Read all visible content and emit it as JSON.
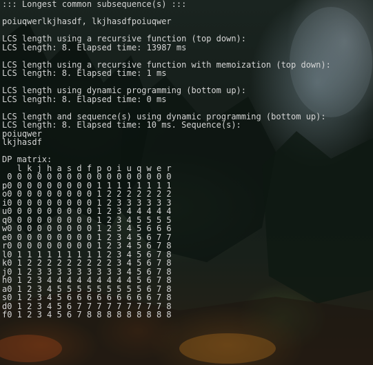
{
  "console": {
    "lines": [
      "::: Longest common subsequence(s) :::",
      "",
      "poiuqwerlkjhasdf, lkjhasdfpoiuqwer",
      "",
      "LCS length using a recursive function (top down):",
      "LCS length: 8. Elapsed time: 13987 ms",
      "",
      "LCS length using a recursive function with memoization (top down):",
      "LCS length: 8. Elapsed time: 1 ms",
      "",
      "LCS length using dynamic programming (bottom up):",
      "LCS length: 8. Elapsed time: 0 ms",
      "",
      "LCS length and sequence(s) using dynamic programming (bottom up):",
      "LCS length: 8. Elapsed time: 10 ms. Sequence(s):",
      "poiuqwer",
      "lkjhasdf",
      "",
      "DP matrix:",
      "   l k j h a s d f p o i u q w e r",
      " 0 0 0 0 0 0 0 0 0 0 0 0 0 0 0 0 0",
      "p0 0 0 0 0 0 0 0 0 1 1 1 1 1 1 1 1",
      "o0 0 0 0 0 0 0 0 0 1 2 2 2 2 2 2 2",
      "i0 0 0 0 0 0 0 0 0 1 2 3 3 3 3 3 3",
      "u0 0 0 0 0 0 0 0 0 1 2 3 4 4 4 4 4",
      "q0 0 0 0 0 0 0 0 0 1 2 3 4 5 5 5 5",
      "w0 0 0 0 0 0 0 0 0 1 2 3 4 5 6 6 6",
      "e0 0 0 0 0 0 0 0 0 1 2 3 4 5 6 7 7",
      "r0 0 0 0 0 0 0 0 0 1 2 3 4 5 6 7 8",
      "l0 1 1 1 1 1 1 1 1 1 2 3 4 5 6 7 8",
      "k0 1 2 2 2 2 2 2 2 2 2 3 4 5 6 7 8",
      "j0 1 2 3 3 3 3 3 3 3 3 3 4 5 6 7 8",
      "h0 1 2 3 4 4 4 4 4 4 4 4 4 5 6 7 8",
      "a0 1 2 3 4 5 5 5 5 5 5 5 5 5 6 7 8",
      "s0 1 2 3 4 5 6 6 6 6 6 6 6 6 6 7 8",
      "d0 1 2 3 4 5 6 7 7 7 7 7 7 7 7 7 8",
      "f0 1 2 3 4 5 6 7 8 8 8 8 8 8 8 8 8",
      "",
      "",
      "",
      ""
    ]
  },
  "colors": {
    "text": "#d6d6d6"
  }
}
